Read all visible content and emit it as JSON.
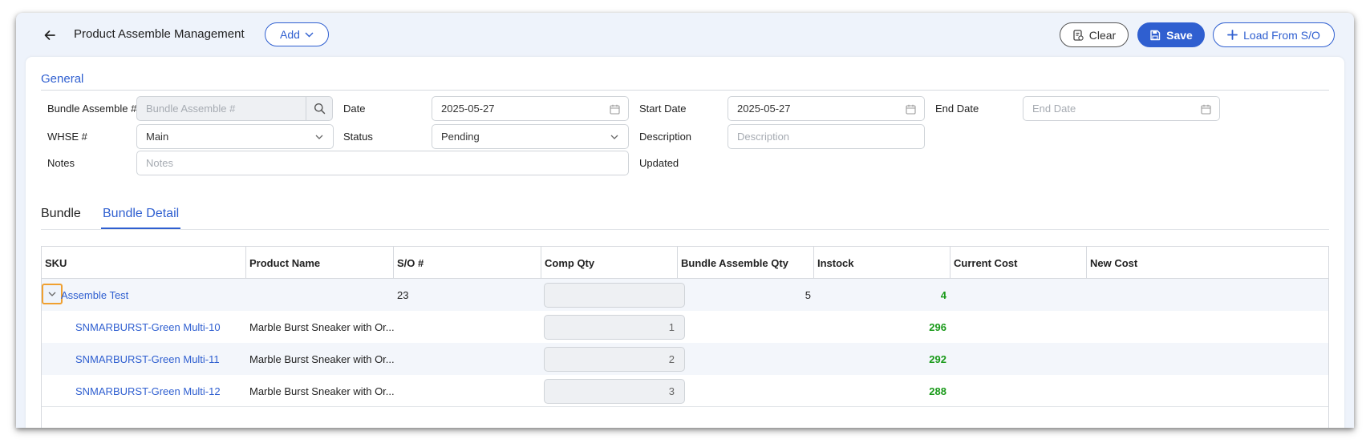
{
  "header": {
    "title": "Product Assemble Management",
    "add_label": "Add",
    "clear_label": "Clear",
    "save_label": "Save",
    "load_label": "Load From S/O"
  },
  "general": {
    "section_title": "General",
    "bundle_assemble_label": "Bundle Assemble #",
    "bundle_assemble_placeholder": "Bundle Assemble #",
    "date_label": "Date",
    "date_value": "2025-05-27",
    "start_date_label": "Start Date",
    "start_date_value": "2025-05-27",
    "end_date_label": "End Date",
    "end_date_placeholder": "End Date",
    "whse_label": "WHSE #",
    "whse_value": "Main",
    "status_label": "Status",
    "status_value": "Pending",
    "description_label": "Description",
    "description_placeholder": "Description",
    "notes_label": "Notes",
    "notes_placeholder": "Notes",
    "updated_label": "Updated"
  },
  "tabs": [
    {
      "label": "Bundle",
      "active": false
    },
    {
      "label": "Bundle Detail",
      "active": true
    }
  ],
  "table": {
    "columns": [
      "SKU",
      "Product Name",
      "S/O #",
      "Comp Qty",
      "Bundle Assemble Qty",
      "Instock",
      "Current Cost",
      "New Cost"
    ],
    "parent": {
      "sku": "Assemble Test",
      "so": "23",
      "bundle_qty": "5",
      "instock": "4"
    },
    "children": [
      {
        "sku": "SNMARBURST-Green Multi-10",
        "product_name": "Marble Burst Sneaker with Or...",
        "comp_qty": "1",
        "instock": "296"
      },
      {
        "sku": "SNMARBURST-Green Multi-11",
        "product_name": "Marble Burst Sneaker with Or...",
        "comp_qty": "2",
        "instock": "292"
      },
      {
        "sku": "SNMARBURST-Green Multi-12",
        "product_name": "Marble Burst Sneaker with Or...",
        "comp_qty": "3",
        "instock": "288"
      }
    ]
  },
  "colors": {
    "accent": "#2f5fd0",
    "instock_green": "#1a9a1a",
    "highlight": "#f0a030"
  }
}
